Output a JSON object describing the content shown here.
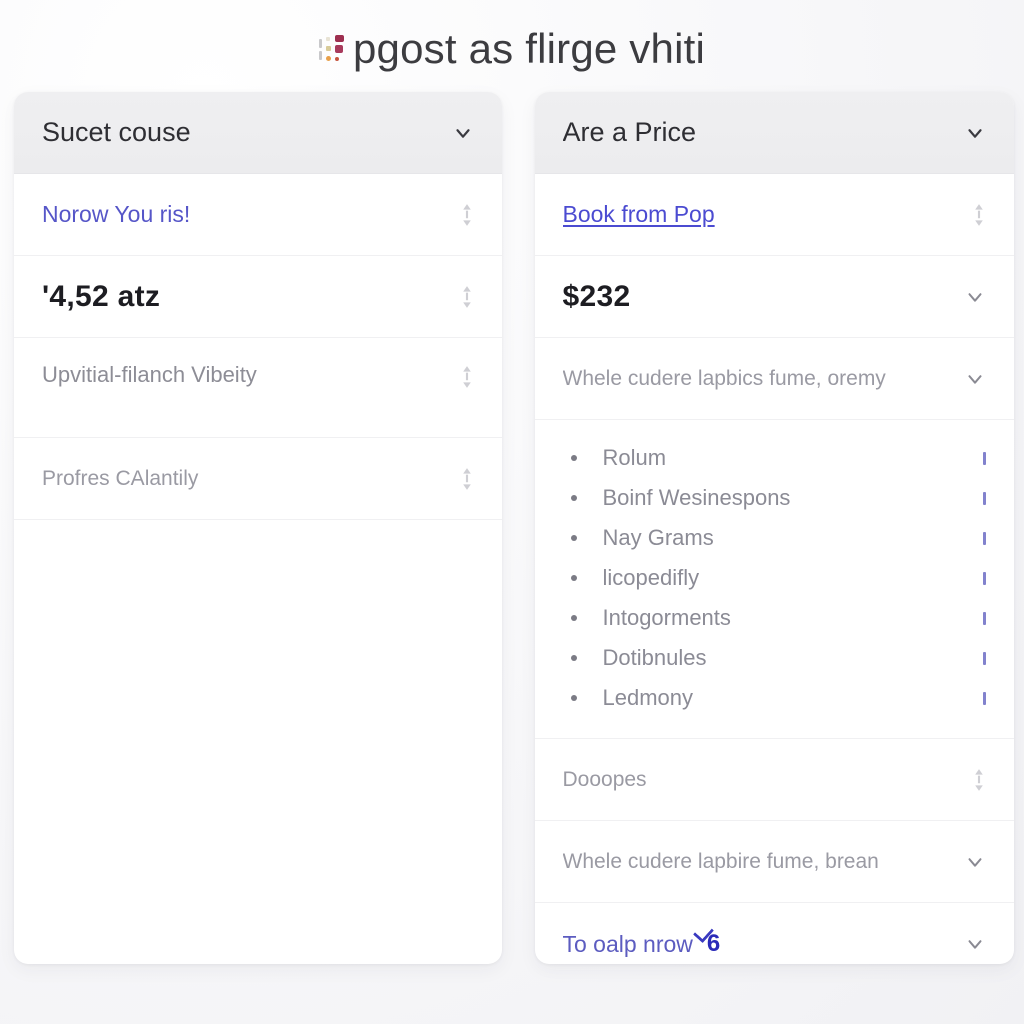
{
  "header": {
    "title": "pgost as flirge vhiti",
    "icon": "color-dots-icon"
  },
  "colors": {
    "accent_blue": "#5656c8",
    "link_blue": "#4b4bd1",
    "badge_blue": "#2a2ab8",
    "text_dark": "#1d1d22",
    "text_muted": "#8b8b95",
    "panel_header_bg": "#ececee",
    "page_bg": "#f7f7f9"
  },
  "left_panel": {
    "header": {
      "label": "Sucet couse",
      "chevron": "chevron-down-icon"
    },
    "rows": [
      {
        "text": "Norow You ris!",
        "style": "link",
        "icon": "sort-updown-icon"
      },
      {
        "text": "'4,52 atz",
        "style": "strong",
        "icon": "sort-updown-icon"
      },
      {
        "text": "Upvitial-filanch Vibeity",
        "style": "two-line",
        "icon": "sort-updown-icon"
      },
      {
        "text": "Profres CAlantily",
        "style": "faint",
        "icon": "sort-updown-icon"
      }
    ]
  },
  "right_panel": {
    "header": {
      "label": "Are a Price",
      "chevron": "chevron-down-icon"
    },
    "rows": [
      {
        "text": "Book from Pop",
        "style": "link-underline",
        "icon": "sort-updown-icon"
      },
      {
        "text": "$232",
        "style": "strong",
        "icon": "chevron-down-icon"
      },
      {
        "text": "Whele cudere lapbics fume, oremy",
        "style": "faint",
        "icon": "chevron-down-icon"
      }
    ],
    "bullets": [
      {
        "text": "Rolum",
        "marker": "blue-bar-icon"
      },
      {
        "text": "Boinf Wesinespons",
        "marker": "blue-bar-icon"
      },
      {
        "text": "Nay Grams",
        "marker": "blue-bar-icon"
      },
      {
        "text": "licopedifly",
        "marker": "blue-bar-icon"
      },
      {
        "text": "Intogorments",
        "marker": "blue-bar-icon"
      },
      {
        "text": "Dotibnules",
        "marker": "blue-bar-icon"
      },
      {
        "text": "Ledmony",
        "marker": "blue-bar-icon"
      }
    ],
    "footer_rows": [
      {
        "text": "Dooopes",
        "style": "faint",
        "icon": "sort-updown-icon"
      },
      {
        "text": "Whele cudere lapbire fume, brean",
        "style": "faint",
        "icon": "chevron-down-icon"
      }
    ],
    "last_row": {
      "text": "To oalp nrow",
      "badge": "6",
      "icon": "chevron-down-icon"
    }
  }
}
